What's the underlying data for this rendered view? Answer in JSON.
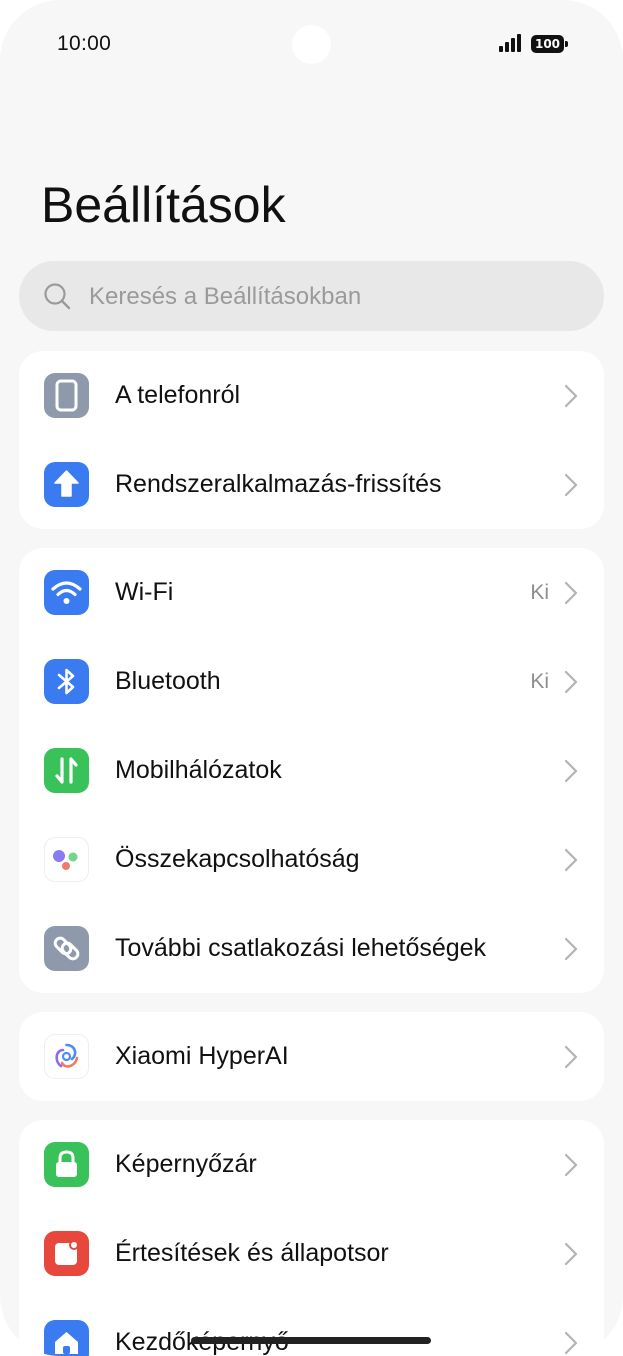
{
  "status_bar": {
    "time": "10:00",
    "battery": "100"
  },
  "page_title": "Beállítások",
  "search": {
    "placeholder": "Keresés a Beállításokban"
  },
  "groups": [
    {
      "items": [
        {
          "label": "A telefonról",
          "icon": "phone-icon",
          "icon_color": "#8e9aab",
          "value": ""
        },
        {
          "label": "Rendszeralkalmazás-frissítés",
          "icon": "update-arrow-icon",
          "icon_color": "#3b7bf2",
          "value": ""
        }
      ]
    },
    {
      "items": [
        {
          "label": "Wi-Fi",
          "icon": "wifi-icon",
          "icon_color": "#3b7bf2",
          "value": "Ki"
        },
        {
          "label": "Bluetooth",
          "icon": "bluetooth-icon",
          "icon_color": "#3b7bf2",
          "value": "Ki"
        },
        {
          "label": "Mobilhálózatok",
          "icon": "mobile-data-icon",
          "icon_color": "#39c25a",
          "value": ""
        },
        {
          "label": "Összekapcsolhatóság",
          "icon": "connectivity-dots-icon",
          "icon_color": "#ffffff",
          "value": ""
        },
        {
          "label": "További csatlakozási lehetőségek",
          "icon": "link-icon",
          "icon_color": "#8e9aab",
          "value": ""
        }
      ]
    },
    {
      "items": [
        {
          "label": "Xiaomi HyperAI",
          "icon": "hyperai-swirl-icon",
          "icon_color": "#ffffff",
          "value": ""
        }
      ]
    },
    {
      "items": [
        {
          "label": "Képernyőzár",
          "icon": "lock-icon",
          "icon_color": "#39c25a",
          "value": ""
        },
        {
          "label": "Értesítések és állapotsor",
          "icon": "notification-icon",
          "icon_color": "#e8483c",
          "value": ""
        },
        {
          "label": "Kezdőképernyő",
          "icon": "home-icon",
          "icon_color": "#3b7bf2",
          "value": ""
        }
      ]
    }
  ]
}
